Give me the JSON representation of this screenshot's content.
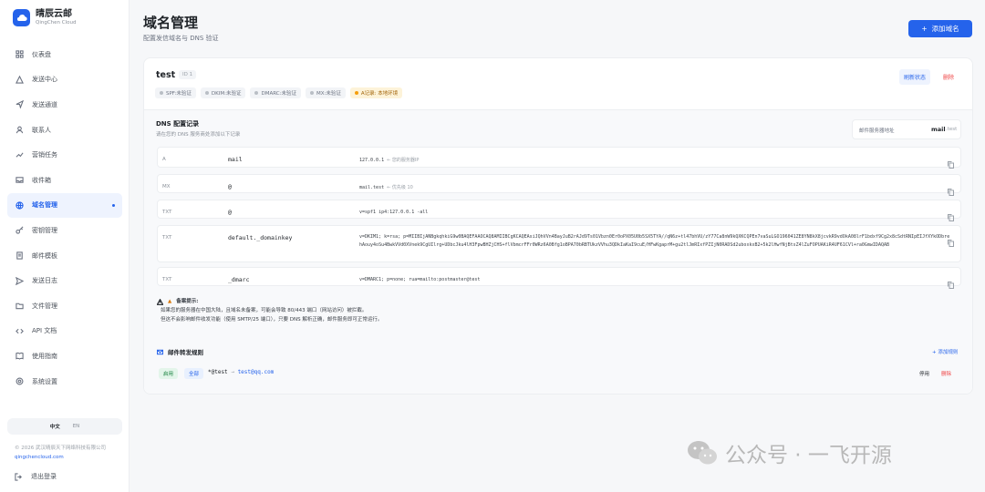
{
  "brand": {
    "name": "晴辰云邮",
    "sub": "QingChen Cloud"
  },
  "nav": [
    {
      "label": "仪表盘",
      "icon": "grid-icon"
    },
    {
      "label": "发送中心",
      "icon": "send-icon"
    },
    {
      "label": "发送通道",
      "icon": "channel-icon"
    },
    {
      "label": "联系人",
      "icon": "user-icon"
    },
    {
      "label": "营销任务",
      "icon": "task-icon"
    },
    {
      "label": "收件箱",
      "icon": "inbox-icon"
    },
    {
      "label": "域名管理",
      "icon": "globe-icon",
      "active": true
    },
    {
      "label": "密钥管理",
      "icon": "key-icon"
    },
    {
      "label": "邮件模板",
      "icon": "template-icon"
    },
    {
      "label": "发送日志",
      "icon": "log-icon"
    },
    {
      "label": "文件管理",
      "icon": "folder-icon"
    },
    {
      "label": "API 文档",
      "icon": "code-icon"
    },
    {
      "label": "使用指南",
      "icon": "book-icon"
    },
    {
      "label": "系统设置",
      "icon": "gear-icon"
    }
  ],
  "lang": {
    "zh": "中文",
    "en": "EN"
  },
  "footer": {
    "copyright": "© 2026 武汉晴辰天下网络科技有限公司",
    "site": "qingchencloud.com",
    "logout": "退出登录"
  },
  "header": {
    "title": "域名管理",
    "subtitle": "配置发信域名与 DNS 验证",
    "add_button": "添加域名"
  },
  "domain": {
    "name": "test",
    "id_label": "ID 1",
    "badges": [
      {
        "label": "SPF:未验证",
        "status": "gray"
      },
      {
        "label": "DKIM:未验证",
        "status": "gray"
      },
      {
        "label": "DMARC:未验证",
        "status": "gray"
      },
      {
        "label": "MX:未验证",
        "status": "gray"
      },
      {
        "label": "A记录: 本地环境",
        "status": "warn"
      }
    ],
    "refresh_label": "刷新状态",
    "delete_label": "删除"
  },
  "dns": {
    "title": "DNS 配置记录",
    "subtitle": "请在您的 DNS 服务商处添加以下记录",
    "server_label": "邮件服务器地址",
    "server_value": "mail",
    "server_suffix": ".test",
    "records": [
      {
        "type": "A",
        "host": "mail",
        "value": "127.0.0.1",
        "hint": "← 您的服务器IP"
      },
      {
        "type": "MX",
        "host": "@",
        "value": "mail.test",
        "hint": "← 优先级 10"
      },
      {
        "type": "TXT",
        "host": "@",
        "value": "v=spf1 ip4:127.0.0.1 -all",
        "hint": ""
      },
      {
        "type": "TXT",
        "host": "default._domainkey",
        "value": "v=DKIM1; k=rsa; p=MIIBIjANBgkqhkiG9w0BAQEFAAOCAQ8AMIIBCgKCAQEAsiJQhVVn4BayJuB2rAJd9Ts01Vbzn0Er0oPX05U0b5SX5TYA//qN6z+tl47bhVU/zY77Ca8nW9kQXKCQPEn7vaSuLGO196041ZE8YN8kX8jcvkR9vdOkA08lrF1bdxf9Cg2x8cSdtRNIpEIJfXYkODbrehAouy4oSu4BwkVVd0XVnek9CgUIlrg+UDbcJku4lH3FpwBHZjCHS+flVbmcrFFr0WRz6A0Bfg1oBPA70bRBTUkzVVhu3QDkIaKaI9cuE/HFwKgaprM+gu2tlJmRIxfPZIjN0RADSd2uboxkxB2+5k2lHwfNjBtsZ4lZuFOPUAKiR4UF61CVl+ra0GmwIDAQAB",
        "hint": ""
      },
      {
        "type": "TXT",
        "host": "_dmarc",
        "value": "v=DMARC1; p=none; rua=mailto:postmaster@test",
        "hint": ""
      }
    ]
  },
  "notice": {
    "title": "备案提示:",
    "lines": [
      "如果您的服务器在中国大陆，且域名未备案，可能会导致 80/443 端口（网站访问）被拦截。",
      "但这不会影响邮件收发功能（使用 SMTP/25 端口），只要 DNS 解析正确，邮件服务即可正常运行。"
    ]
  },
  "forwarding": {
    "title": "邮件转发规则",
    "add_label": "+ 添加规则",
    "rules": [
      {
        "status": "启用",
        "scope": "全部",
        "source": "*@test",
        "arrow": "→",
        "dest": "test@qq.com",
        "stop_label": "停用",
        "delete_label": "删除"
      }
    ]
  },
  "watermark": {
    "text": "公众号 · 一飞开源"
  }
}
